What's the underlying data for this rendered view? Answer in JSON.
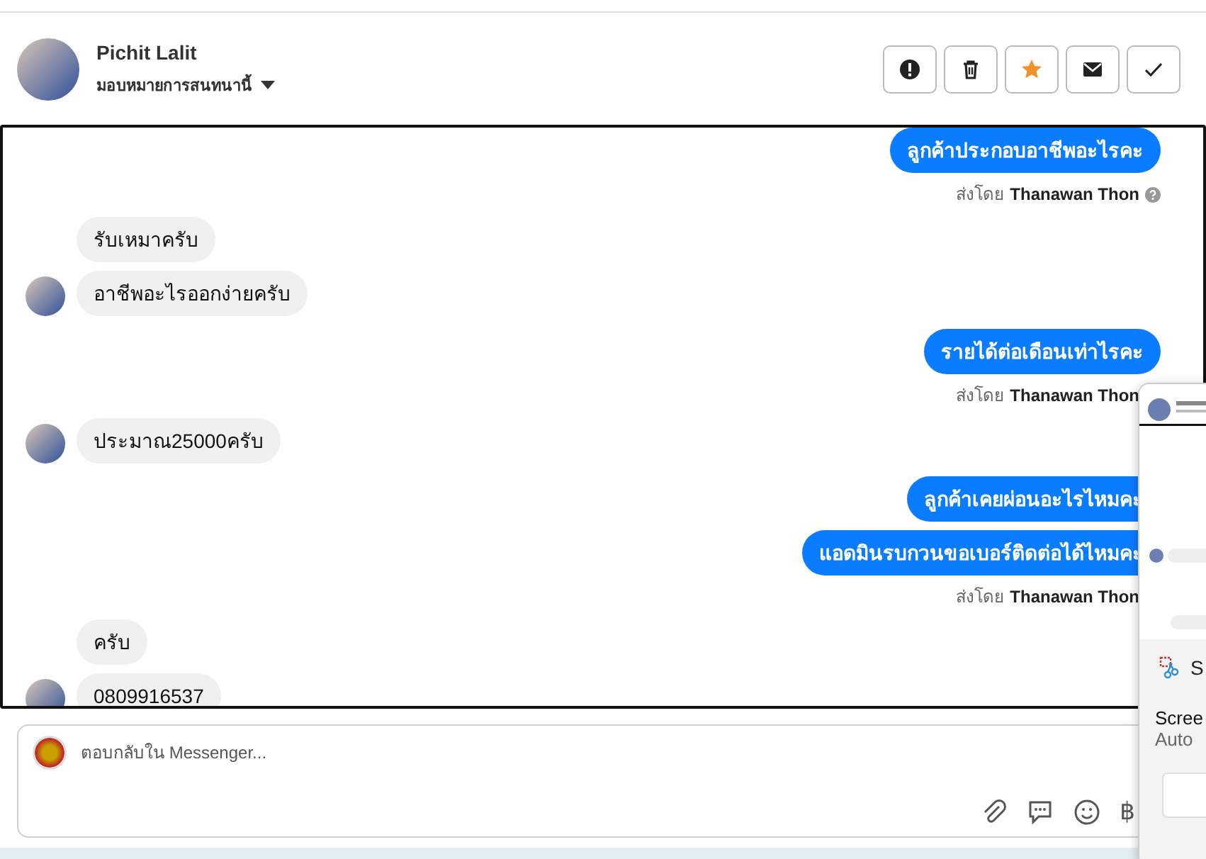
{
  "header": {
    "name": "Pichit Lalit",
    "assign_label": "มอบหมายการสนทนานี้",
    "actions": [
      {
        "kind": "spam",
        "active": false
      },
      {
        "kind": "delete",
        "active": false
      },
      {
        "kind": "star",
        "active": true
      },
      {
        "kind": "unread",
        "active": false
      },
      {
        "kind": "done",
        "active": false
      }
    ]
  },
  "chat": {
    "groups": [
      {
        "kind": "outgoing",
        "messages": [
          "ลูกค้าประกอบอาชีพอะไรคะ"
        ],
        "sent_by": {
          "label": "ส่งโดย",
          "name": "Thanawan Thon"
        }
      },
      {
        "kind": "incoming",
        "messages": [
          "รับเหมาครับ",
          "อาชีพอะไรออกง่ายครับ"
        ]
      },
      {
        "kind": "outgoing",
        "messages": [
          "รายได้ต่อเดือนเท่าไรคะ"
        ],
        "sent_by": {
          "label": "ส่งโดย",
          "name": "Thanawan Thon"
        }
      },
      {
        "kind": "incoming",
        "messages": [
          "ประมาณ25000ครับ"
        ]
      },
      {
        "kind": "outgoing",
        "messages": [
          "ลูกค้าเคยผ่อนอะไรไหมคะ",
          "แอดมินรบกวนขอเบอร์ติดต่อได้ไหมคะ"
        ],
        "sent_by": {
          "label": "ส่งโดย",
          "name": "Thanawan Thon"
        }
      },
      {
        "kind": "incoming",
        "messages": [
          "ครับ",
          "0809916537"
        ]
      }
    ]
  },
  "composer": {
    "placeholder": "ตอบกลับใน Messenger...",
    "currency_symbol": "฿"
  },
  "snip_popup": {
    "app_letter": "S",
    "title": "Scree",
    "subtitle": "Auto"
  }
}
